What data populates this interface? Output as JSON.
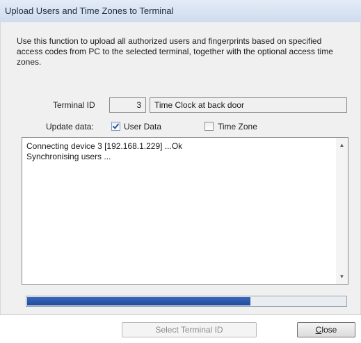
{
  "window": {
    "title": "Upload Users and Time Zones to Terminal"
  },
  "description": "Use this function to upload all authorized users and fingerprints based on specified access codes from PC to the selected terminal, together with the optional access time zones.",
  "terminal": {
    "label": "Terminal ID",
    "id_value": "3",
    "name_value": "Time Clock at back door"
  },
  "update": {
    "label": "Update data:",
    "user_data": {
      "label": "User Data",
      "checked": true
    },
    "time_zone": {
      "label": "Time Zone",
      "checked": false
    }
  },
  "log": {
    "lines": "Connecting device 3 [192.168.1.229] ...Ok\nSynchronising users ..."
  },
  "progress": {
    "fraction": 0.7
  },
  "buttons": {
    "select_terminal": "Select Terminal ID",
    "close_prefix": "C",
    "close_rest": "lose"
  },
  "colors": {
    "titlebar": "#d6e2f1",
    "progress_fill": "#2a57a8"
  }
}
